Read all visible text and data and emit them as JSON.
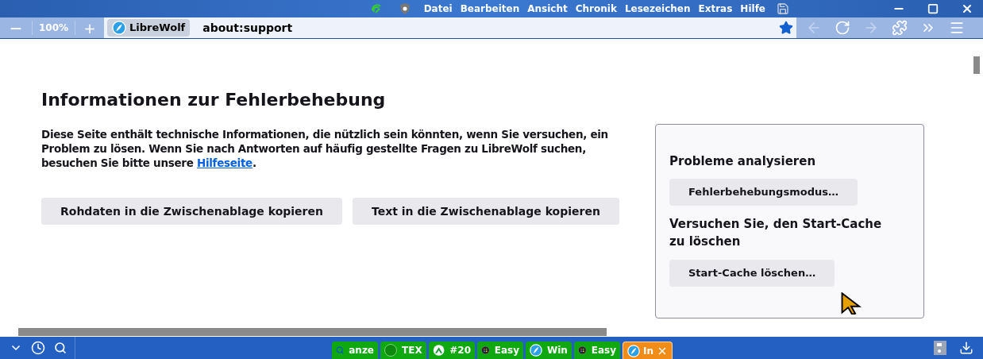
{
  "menu_bar": {
    "items": [
      "Datei",
      "Bearbeiten",
      "Ansicht",
      "Chronik",
      "Lesezeichen",
      "Extras",
      "Hilfe"
    ]
  },
  "toolbar": {
    "zoom_out": "—",
    "zoom_level": "100%",
    "zoom_in": "+",
    "identity": "LibreWolf",
    "url": "about:support",
    "bookmarked": true
  },
  "page": {
    "title": "Informationen zur Fehlerbehebung",
    "intro": "Diese Seite enthält technische Informationen, die nützlich sein könnten, wenn Sie versuchen, ein Problem zu lösen. Wenn Sie nach Antworten auf häufig gestellte Fragen zu LibreWolf suchen, besuchen Sie bitte unsere ",
    "intro_link": "Hilfeseite",
    "intro_end": ".",
    "buttons": [
      "Rohdaten in die Zwischenablage kopieren",
      "Text in die Zwischenablage kopieren"
    ],
    "side_box": {
      "heading_1": "Probleme analysieren",
      "button_1": "Fehlerbehebungsmodus…",
      "heading_2": "Versuchen Sie, den Start-Cache zu löschen",
      "button_2": "Start-Cache löschen…"
    }
  },
  "taskbar": {
    "items": [
      {
        "kind": "search",
        "label": "anze",
        "selected": false
      },
      {
        "kind": "dot",
        "label": "TEX",
        "selected": false
      },
      {
        "kind": "arrow",
        "label": "#20",
        "selected": false
      },
      {
        "kind": "grid",
        "label": "Easy",
        "selected": false
      },
      {
        "kind": "wolf",
        "label": "Win",
        "selected": false
      },
      {
        "kind": "grid",
        "label": "Easy",
        "selected": false
      },
      {
        "kind": "wolf",
        "label": "In",
        "selected": true
      }
    ]
  }
}
